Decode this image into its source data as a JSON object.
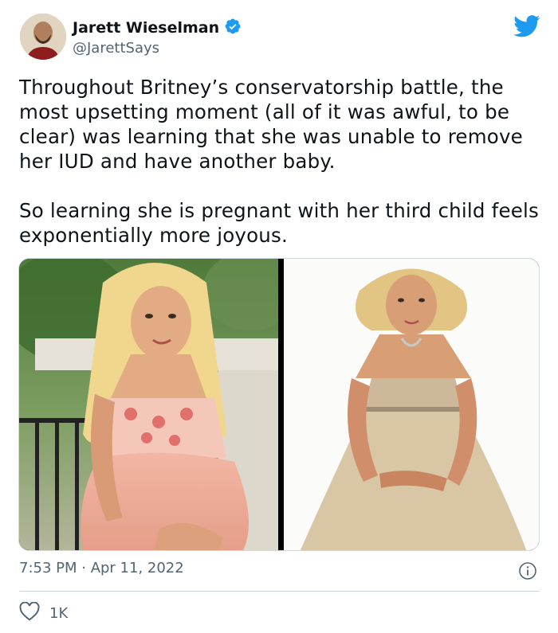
{
  "author": {
    "display_name": "Jarett Wieselman",
    "handle": "@JarettSays",
    "verified": true
  },
  "tweet": {
    "paragraphs": [
      "Throughout Britney’s conservatorship battle, the most upsetting moment (all of it was awful, to be clear) was learning that she was unable to remove her IUD and have another baby.",
      "So learning she is pregnant with her third child feels exponentially more joyous."
    ],
    "timestamp": "7:53 PM · Apr 11, 2022",
    "likes": "1K"
  },
  "icons": {
    "twitter": "twitter-bird-icon",
    "verified": "verified-badge-icon",
    "info": "info-icon",
    "like": "heart-icon"
  },
  "colors": {
    "brand": "#1d9bf0",
    "text": "#0f1419",
    "secondary": "#536471",
    "border": "#cfd9de"
  }
}
